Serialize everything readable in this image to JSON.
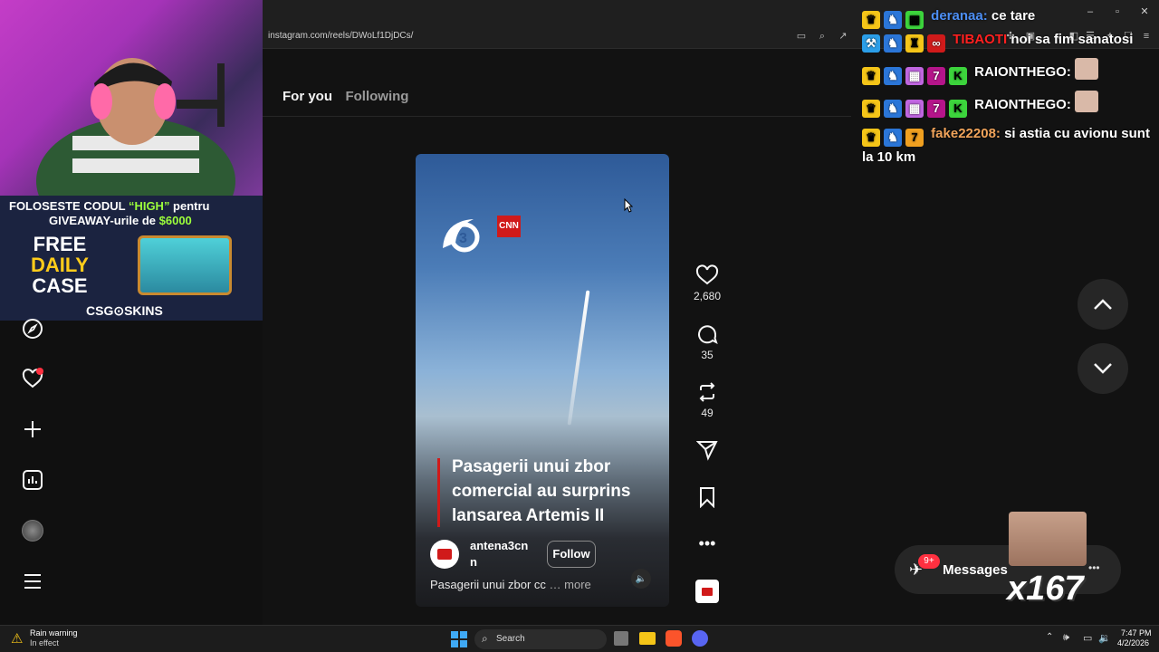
{
  "browser": {
    "url": "instagram.com/reels/DWoLf1DjDCs/"
  },
  "feed": {
    "tabs": [
      {
        "label": "For you"
      },
      {
        "label": "Following"
      }
    ]
  },
  "overlay": {
    "promo_line1_a": "FOLOSESTE CODUL ",
    "promo_code": "“HIGH”",
    "promo_line1_b": " pentru",
    "promo_line2_a": "GIVEAWAY-urile de ",
    "promo_amount": "$6000",
    "free": "FREE",
    "daily": "DAILY",
    "case": "CASE",
    "brand": "CSG⊙SKINS"
  },
  "reel": {
    "logo_badge": "CNN",
    "title": "Pasagerii unui zbor comercial au surprins lansarea Artemis II",
    "author": "antena3cnn",
    "follow_label": "Follow",
    "caption": "Pasagerii unui zbor cc",
    "more_label": "… more"
  },
  "actions": {
    "likes": "2,680",
    "comments": "35",
    "reposts": "49"
  },
  "chat": [
    {
      "user": "deranaa:",
      "user_color": "#4d8ff5",
      "msg": "ce tare"
    },
    {
      "user": "TIBAOTI",
      "user_color": "#ff2020",
      "msg": "noi sa fim sanatosi"
    },
    {
      "user": "RAIONTHEGO:",
      "user_color": "#ffffff",
      "msg": ""
    },
    {
      "user": "RAIONTHEGO:",
      "user_color": "#ffffff",
      "msg": ""
    },
    {
      "user": "fake22208:",
      "user_color": "#f0a35a",
      "msg": "si astia cu avionu sunt la 10 km"
    }
  ],
  "messages": {
    "label": "Messages",
    "badge": "9+",
    "gift_count": "x167"
  },
  "taskbar": {
    "weather_title": "Rain warning",
    "weather_sub": "In effect",
    "search_label": "Search",
    "time": "7:47 PM",
    "date": "4/2/2026"
  },
  "colors": {
    "accent_red": "#d01a1a",
    "notification_red": "#ff3040",
    "page_bg": "#121212"
  }
}
